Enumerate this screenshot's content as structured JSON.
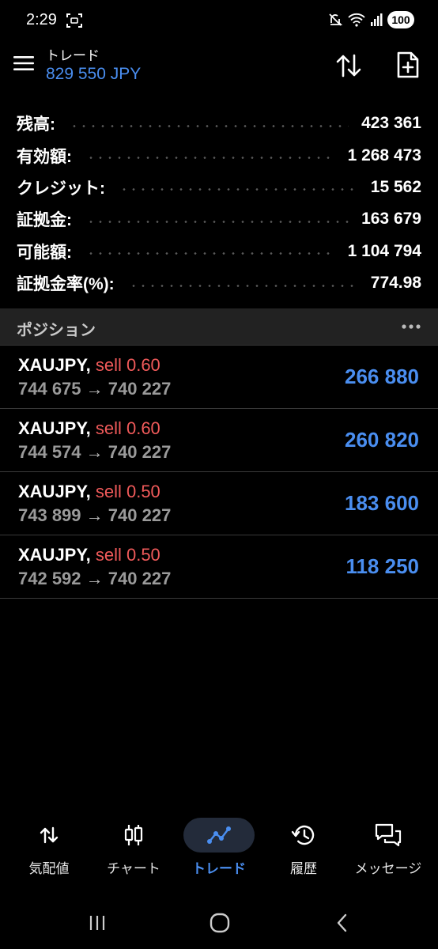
{
  "status_bar": {
    "time": "2:29",
    "battery": "100"
  },
  "header": {
    "title": "トレード",
    "balance_line": "829 550 JPY"
  },
  "summary": [
    {
      "label": "残高:",
      "value": "423 361"
    },
    {
      "label": "有効額:",
      "value": "1 268 473"
    },
    {
      "label": "クレジット:",
      "value": "15 562"
    },
    {
      "label": "証拠金:",
      "value": "163 679"
    },
    {
      "label": "可能額:",
      "value": "1 104 794"
    },
    {
      "label": "証拠金率(%):",
      "value": "774.98"
    }
  ],
  "positions": {
    "title": "ポジション",
    "items": [
      {
        "symbol": "XAUJPY,",
        "side": "sell 0.60",
        "open_price": "744 675",
        "arrow": "→",
        "current_price": "740 227",
        "profit": "266 880"
      },
      {
        "symbol": "XAUJPY,",
        "side": "sell 0.60",
        "open_price": "744 574",
        "arrow": "→",
        "current_price": "740 227",
        "profit": "260 820"
      },
      {
        "symbol": "XAUJPY,",
        "side": "sell 0.50",
        "open_price": "743 899",
        "arrow": "→",
        "current_price": "740 227",
        "profit": "183 600"
      },
      {
        "symbol": "XAUJPY,",
        "side": "sell 0.50",
        "open_price": "742 592",
        "arrow": "→",
        "current_price": "740 227",
        "profit": "118 250"
      }
    ]
  },
  "bottom_nav": [
    {
      "label": "気配値",
      "icon": "quotes-arrows-icon"
    },
    {
      "label": "チャート",
      "icon": "candlestick-icon"
    },
    {
      "label": "トレード",
      "icon": "trade-line-icon",
      "active": true
    },
    {
      "label": "履歴",
      "icon": "history-icon"
    },
    {
      "label": "メッセージ",
      "icon": "messages-icon"
    }
  ],
  "colors": {
    "accent_blue": "#4a8ef0",
    "sell_red": "#f05a5a",
    "background": "#000000"
  }
}
